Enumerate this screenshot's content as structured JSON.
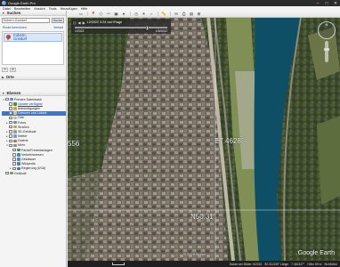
{
  "window": {
    "title": "Google Earth Pro",
    "controls": [
      "–",
      "□",
      "✕"
    ]
  },
  "menu": [
    "Datei",
    "Bearbeiten",
    "Ansicht",
    "Tools",
    "Hinzufügen",
    "Hilfe"
  ],
  "search": {
    "header": "Suchen",
    "value": "Kobern-Gondorf",
    "button": "Suche",
    "links": [
      "Route berechnen",
      "Verlauf"
    ],
    "result": "Kobern-\nGondorf"
  },
  "places": {
    "header": "Orte"
  },
  "layers": {
    "header": "Ebenen",
    "items": [
      {
        "label": "Primäre Datenbank",
        "indent": 0,
        "exp": "▾",
        "checked": false,
        "icon": "#6a8cc7"
      },
      {
        "label": "Update verfügbar",
        "indent": 1,
        "exp": "",
        "checked": false,
        "icon": "#3c9c3c",
        "link": true
      },
      {
        "label": "Ankündigungen",
        "indent": 1,
        "exp": "",
        "checked": false,
        "icon": "#d9a13b"
      },
      {
        "label": "Grenzen und Labels",
        "indent": 1,
        "exp": "▸",
        "checked": true,
        "icon": "#c7c7c7",
        "selected": true
      },
      {
        "label": "Orte",
        "indent": 1,
        "exp": "",
        "checked": false,
        "icon": "#e5b84b"
      },
      {
        "label": "Fotos",
        "indent": 1,
        "exp": "▸",
        "checked": false,
        "icon": "#5c8ad6"
      },
      {
        "label": "Straßen",
        "indent": 1,
        "exp": "",
        "checked": false,
        "icon": "#c9a63a"
      },
      {
        "label": "3D-Gebäude",
        "indent": 1,
        "exp": "▸",
        "checked": false,
        "icon": "#9a9a9a"
      },
      {
        "label": "Wetter",
        "indent": 1,
        "exp": "▸",
        "checked": false,
        "icon": "#6aa0d8"
      },
      {
        "label": "Galerie",
        "indent": 1,
        "exp": "▸",
        "checked": false,
        "icon": "#d06a3a"
      },
      {
        "label": "Mehr",
        "indent": 1,
        "exp": "▾",
        "checked": false,
        "icon": "#8c8c8c"
      },
      {
        "label": "Parks/Freizeitanlagen",
        "indent": 2,
        "exp": "",
        "checked": false,
        "icon": "#3c9c3c"
      },
      {
        "label": "Verkehrswesen",
        "indent": 2,
        "exp": "",
        "checked": false,
        "icon": "#4f7fcf"
      },
      {
        "label": "Gewässer",
        "indent": 2,
        "exp": "",
        "checked": false,
        "icon": "#3b8fd6"
      },
      {
        "label": "Wikipedia",
        "indent": 2,
        "exp": "",
        "checked": false,
        "icon": "#777777"
      },
      {
        "label": "Regierung (USA)",
        "indent": 2,
        "exp": "▸",
        "checked": false,
        "icon": "#4a6fb0"
      },
      {
        "label": "Gelände",
        "indent": 0,
        "exp": "",
        "checked": false,
        "icon": "#7aa15c"
      }
    ]
  },
  "time_slider": {
    "label": "12/2022   3:24 von+Rage",
    "start": "1/2022",
    "end": "1/6/2022",
    "position_pct": 78
  },
  "map_labels": {
    "longitude": "E7.4628°",
    "latitude": "N50.31°",
    "left_partial": "556"
  },
  "copyright": "© 2025 Airbus",
  "brand": "Google Earth",
  "status": {
    "date": "Datum der Bilder: 6/2022",
    "coords": "50.311335° Länge",
    "lon": "7.461327°",
    "elev": "Höhe 89 m",
    "view": "Sichthöhe"
  },
  "colors": {
    "titlebar": "#2b2b2b",
    "selection": "#3b78d2",
    "river": "#0f4f66",
    "link": "#1a4fa8"
  }
}
